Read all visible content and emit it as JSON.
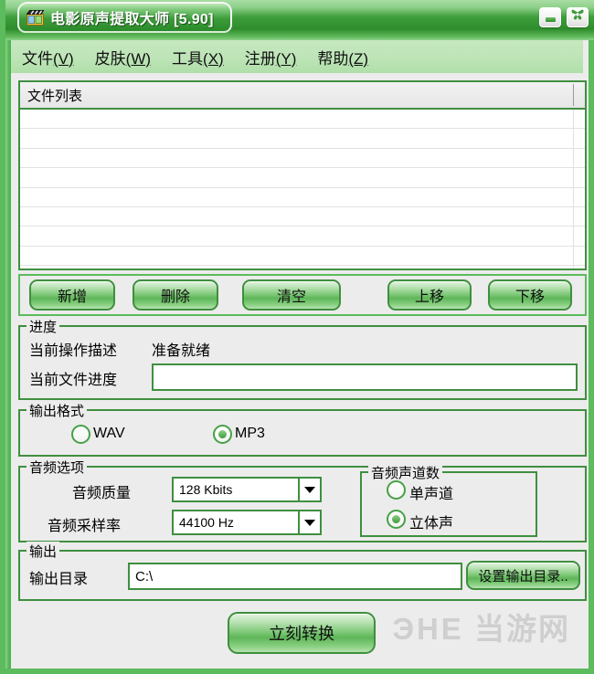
{
  "window": {
    "title": "电影原声提取大师 [5.90]",
    "app_icon": "film-clapper-icon",
    "minimize_label": "最小化",
    "close_label": "关闭",
    "accent_color": "#3f8f3f",
    "titlebar_color": "#2e8c2c",
    "menubar_color": "#bde4b7"
  },
  "menu": {
    "items": [
      {
        "label": "文件",
        "accel": "(V)"
      },
      {
        "label": "皮肤",
        "accel": "(W)"
      },
      {
        "label": "工具",
        "accel": "(X)"
      },
      {
        "label": "注册",
        "accel": "(Y)"
      },
      {
        "label": "帮助",
        "accel": "(Z)"
      }
    ]
  },
  "filelist": {
    "column_header": "文件列表",
    "rows": []
  },
  "actions": {
    "buttons": [
      {
        "label": "新增",
        "name": "add-button"
      },
      {
        "label": "删除",
        "name": "delete-button"
      },
      {
        "label": "清空",
        "name": "clear-button"
      },
      {
        "label": "上移",
        "name": "move-up-button"
      },
      {
        "label": "下移",
        "name": "move-down-button"
      }
    ]
  },
  "progress": {
    "group_title": "进度",
    "operation_label": "当前操作描述",
    "operation_value": "准备就绪",
    "file_progress_label": "当前文件进度",
    "file_progress_percent": 0
  },
  "output_format": {
    "group_title": "输出格式",
    "options": [
      {
        "label": "WAV",
        "selected": false
      },
      {
        "label": "MP3",
        "selected": true
      }
    ]
  },
  "audio_options": {
    "group_title": "音频选项",
    "quality_label": "音频质量",
    "quality_value": "128 Kbits",
    "samplerate_label": "音频采样率",
    "samplerate_value": "44100 Hz",
    "channels": {
      "group_title": "音频声道数",
      "options": [
        {
          "label": "单声道",
          "selected": false
        },
        {
          "label": "立体声",
          "selected": true
        }
      ]
    }
  },
  "output": {
    "group_title": "输出",
    "dir_label": "输出目录",
    "dir_value": "C:\\",
    "browse_label": "设置输出目录.."
  },
  "convert": {
    "label": "立刻转换"
  },
  "watermark": {
    "brand": "ЭHE",
    "site": "当游网"
  }
}
